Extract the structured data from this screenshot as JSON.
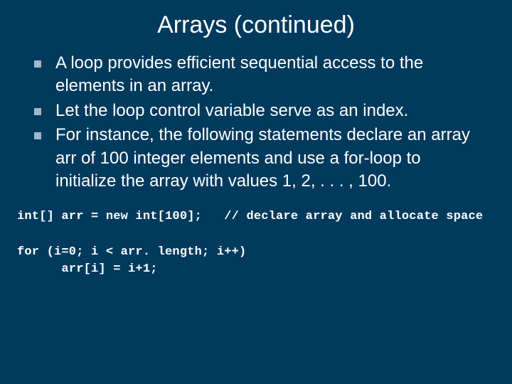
{
  "title": "Arrays (continued)",
  "bullets": [
    "A loop provides efficient sequential access to the elements in an array.",
    "Let the loop control variable serve as an index.",
    "For instance, the following statements declare an array arr of 100 integer elements and use a for-loop to initialize the array with values 1, 2, . . . , 100."
  ],
  "code": "int[] arr = new int[100];   // declare array and allocate space\n\nfor (i=0; i < arr. length; i++)\n      arr[i] = i+1;"
}
